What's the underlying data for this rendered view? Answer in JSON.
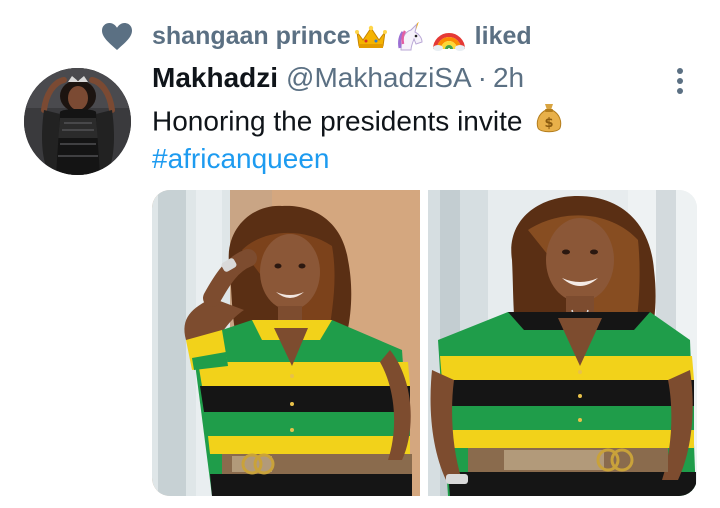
{
  "social_context": {
    "name": "shangaan prince",
    "emojis": [
      "crown-emoji",
      "unicorn-emoji",
      "rainbow-emoji"
    ],
    "action": "liked"
  },
  "tweet": {
    "display_name": "Makhadzi",
    "handle": "@MakhadziSA",
    "separator": "·",
    "timestamp": "2h",
    "text": "Honoring the presidents invite",
    "text_emoji": "money-bag-emoji",
    "hashtag": "#africanqueen",
    "media_count": 2
  },
  "colors": {
    "secondary_text": "#5b7083",
    "link": "#1d9bf0",
    "primary_text": "#0f1419",
    "heart": "#5b7083",
    "dress_green": "#1f9d4a",
    "dress_yellow": "#f2d21a",
    "dress_black": "#151515"
  }
}
